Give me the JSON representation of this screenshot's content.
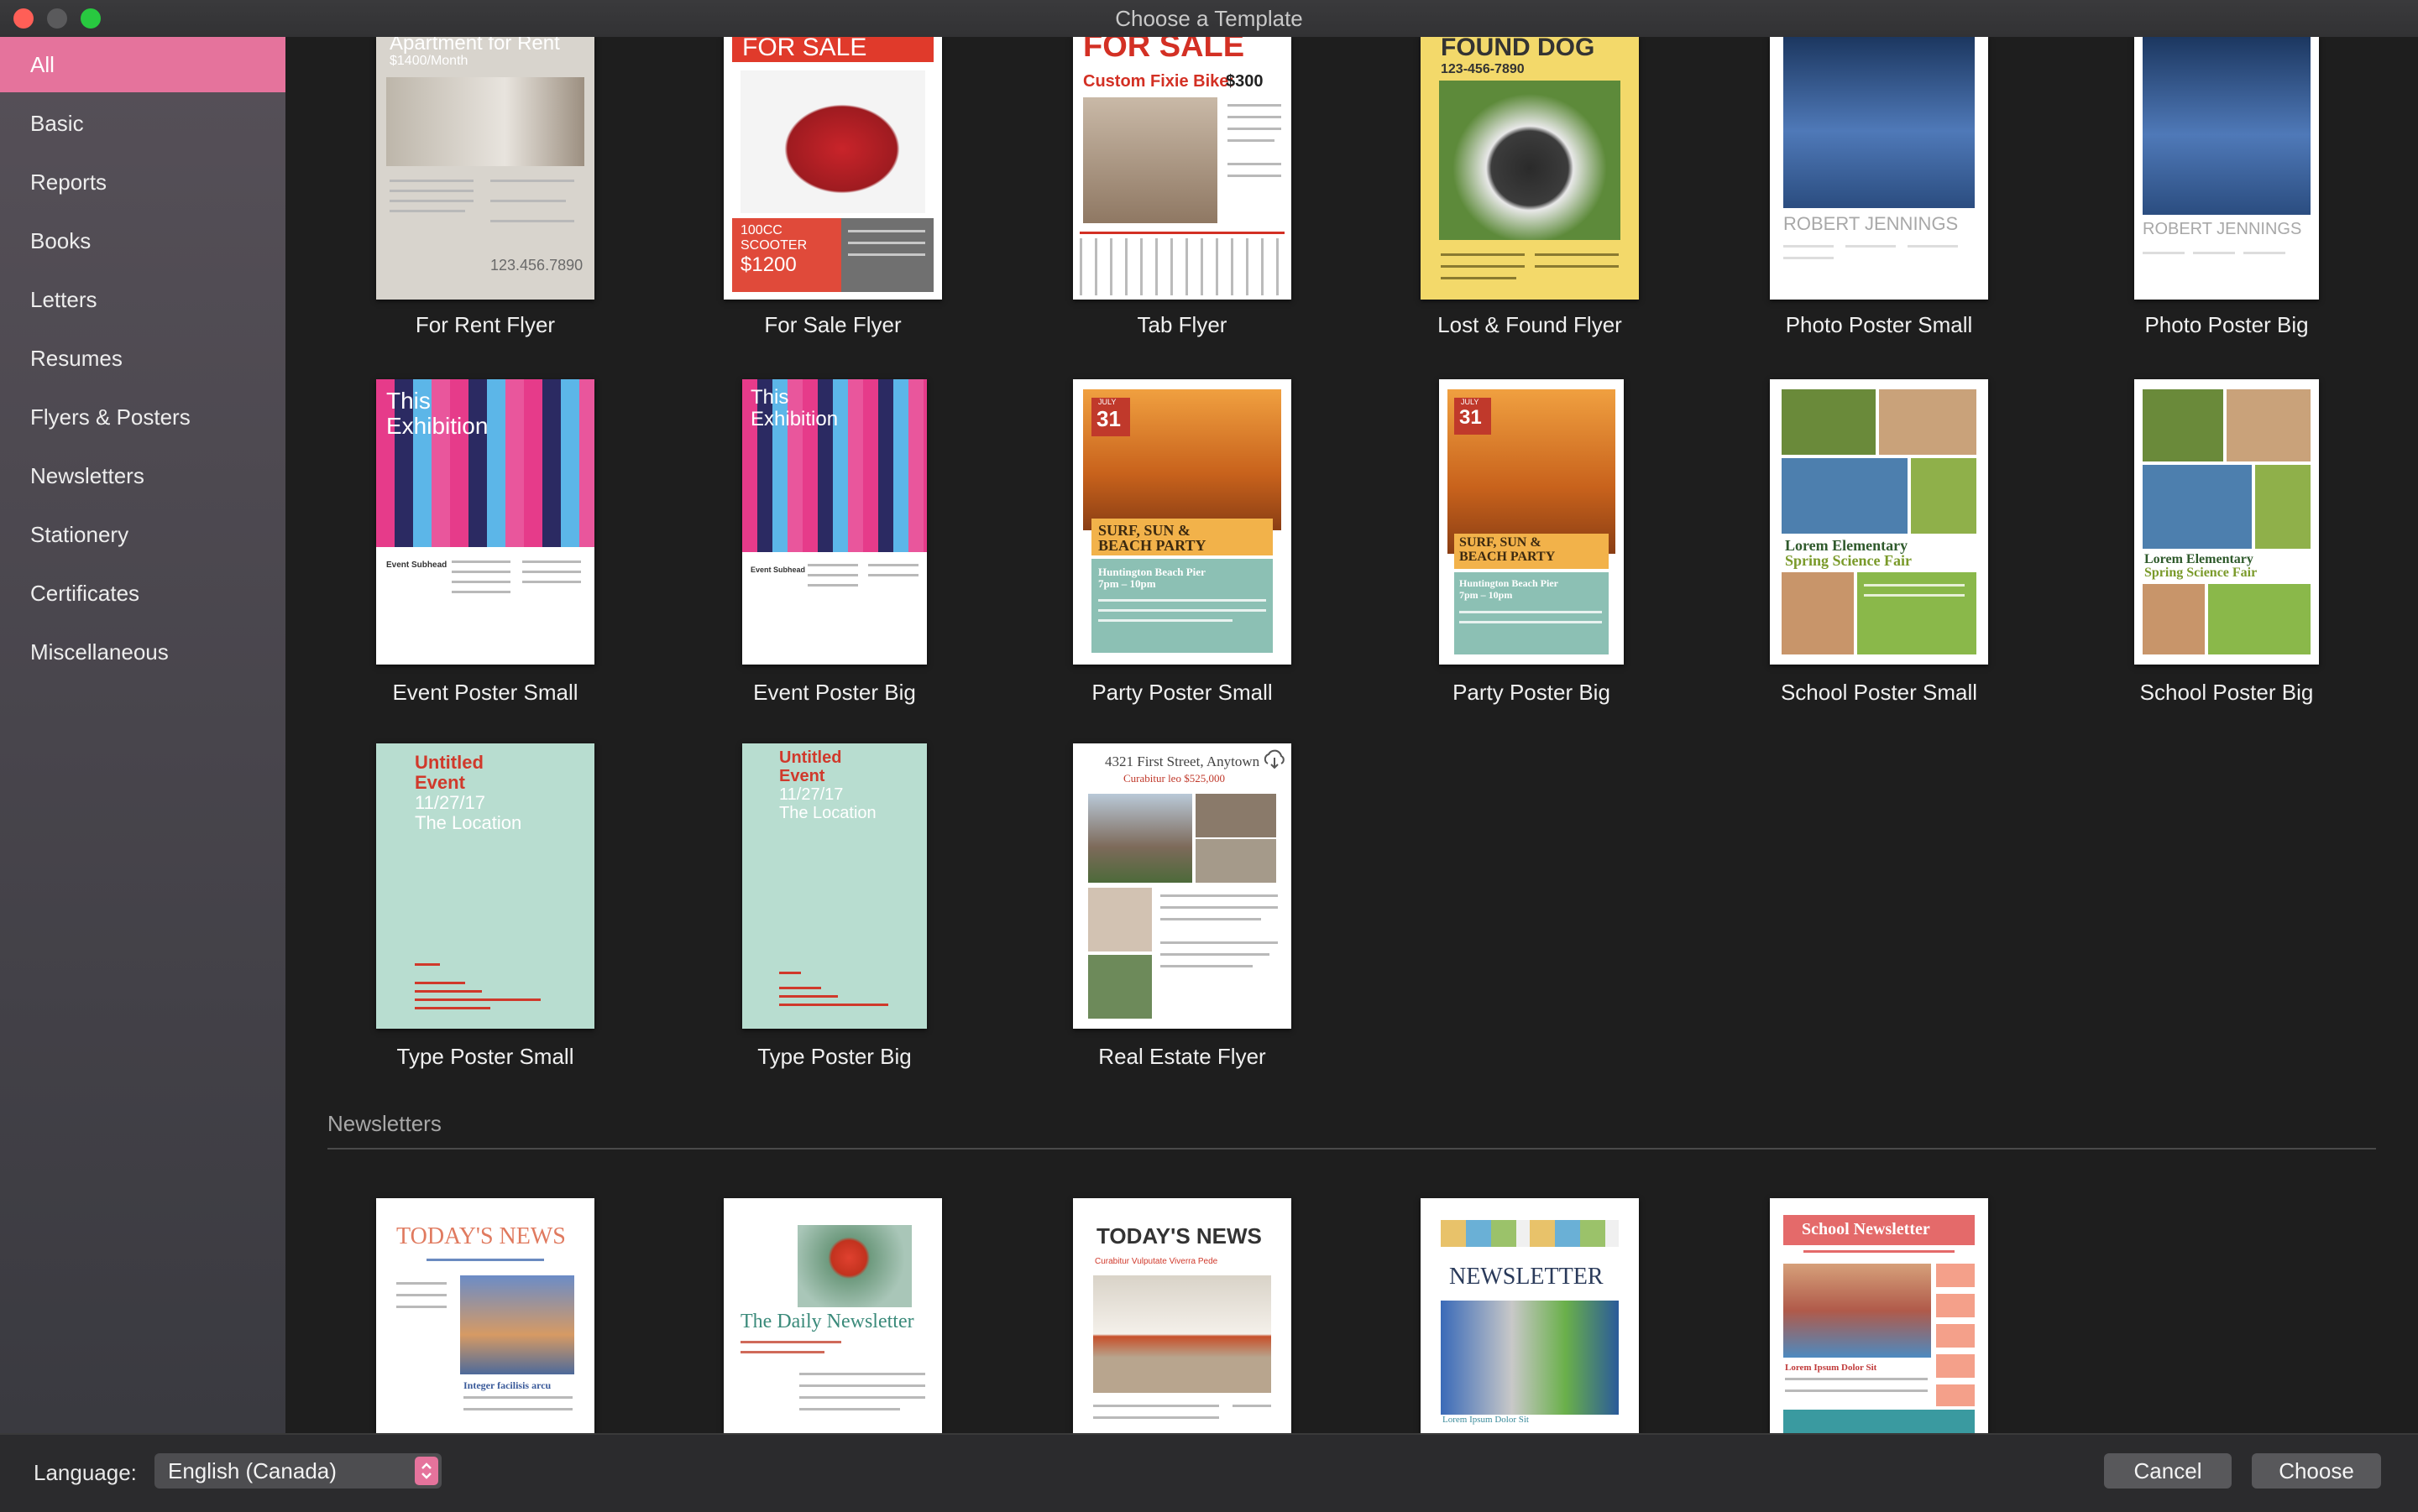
{
  "window": {
    "title": "Choose a Template"
  },
  "sidebar": {
    "items": [
      {
        "label": "All",
        "active": true
      },
      {
        "label": "Basic"
      },
      {
        "label": "Reports"
      },
      {
        "label": "Books"
      },
      {
        "label": "Letters"
      },
      {
        "label": "Resumes"
      },
      {
        "label": "Flyers & Posters"
      },
      {
        "label": "Newsletters"
      },
      {
        "label": "Stationery"
      },
      {
        "label": "Certificates"
      },
      {
        "label": "Miscellaneous"
      }
    ]
  },
  "templates": [
    {
      "label": "For Rent Flyer",
      "thumb": {
        "heading": "Apartment for Rent",
        "sub": "$1400/Month",
        "phone": "123.456.7890"
      }
    },
    {
      "label": "For Sale Flyer",
      "thumb": {
        "heading": "FOR SALE",
        "box_line1": "100CC",
        "box_line2": "SCOOTER",
        "box_price": "$1200"
      }
    },
    {
      "label": "Tab Flyer",
      "thumb": {
        "heading": "FOR SALE",
        "sub": "Custom Fixie Bike:",
        "price": "$300"
      }
    },
    {
      "label": "Lost & Found Flyer",
      "thumb": {
        "heading": "FOUND DOG",
        "phone": "123-456-7890"
      }
    },
    {
      "label": "Photo Poster Small",
      "thumb": {
        "name": "ROBERT JENNINGS"
      }
    },
    {
      "label": "Photo Poster Big",
      "thumb": {
        "name": "ROBERT JENNINGS"
      }
    },
    {
      "label": "Event Poster Small",
      "thumb": {
        "line1": "This",
        "line2": "Exhibition",
        "subhead": "Event Subhead"
      }
    },
    {
      "label": "Event Poster Big",
      "thumb": {
        "line1": "This",
        "line2": "Exhibition",
        "subhead": "Event Subhead"
      }
    },
    {
      "label": "Party Poster Small",
      "thumb": {
        "month": "JULY",
        "day": "31",
        "title1": "SURF, SUN &",
        "title2": "BEACH PARTY",
        "place": "Huntington Beach Pier",
        "time": "7pm – 10pm"
      }
    },
    {
      "label": "Party Poster Big",
      "thumb": {
        "month": "JULY",
        "day": "31",
        "title1": "SURF, SUN &",
        "title2": "BEACH PARTY",
        "place": "Huntington Beach Pier",
        "time": "7pm – 10pm"
      }
    },
    {
      "label": "School Poster Small",
      "thumb": {
        "title1": "Lorem Elementary",
        "title2": "Spring Science Fair"
      }
    },
    {
      "label": "School Poster Big",
      "thumb": {
        "title1": "Lorem Elementary",
        "title2": "Spring Science Fair"
      }
    },
    {
      "label": "Type Poster Small",
      "thumb": {
        "line1": "Untitled",
        "line2": "Event",
        "line3": "11/27/17",
        "line4": "The Location"
      }
    },
    {
      "label": "Type Poster Big",
      "thumb": {
        "line1": "Untitled",
        "line2": "Event",
        "line3": "11/27/17",
        "line4": "The Location"
      }
    },
    {
      "label": "Real Estate Flyer",
      "thumb": {
        "address": "4321 First Street, Anytown",
        "price": "Curabitur leo $525,000"
      },
      "download_icon": "cloud-download-icon"
    }
  ],
  "newsletters_section": {
    "heading": "Newsletters",
    "items": [
      {
        "heading": "TODAY'S NEWS",
        "sub": "Integer facilisis arcu"
      },
      {
        "heading": "The Daily Newsletter"
      },
      {
        "heading": "TODAY'S NEWS",
        "sub": "Curabitur Vulputate Viverra Pede"
      },
      {
        "heading": "NEWSLETTER",
        "sub": "Lorem Ipsum Dolor Sit"
      },
      {
        "heading": "School Newsletter",
        "sub": "Lorem Ipsum Dolor Sit"
      }
    ]
  },
  "footer": {
    "language_label": "Language:",
    "language_value": "English (Canada)",
    "cancel_label": "Cancel",
    "choose_label": "Choose"
  },
  "colors": {
    "accent": "#e5739c",
    "background": "#1e1e1e",
    "sidebar": "#4a464d"
  }
}
